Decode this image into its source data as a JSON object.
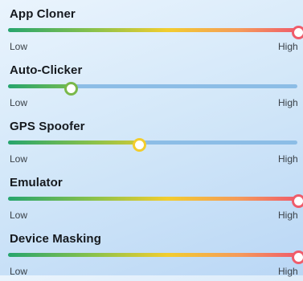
{
  "sliders": [
    {
      "title": "App Cloner",
      "value": 1.0,
      "thumb_color": "#ef5c6b",
      "low": "Low",
      "high": "High"
    },
    {
      "title": "Auto-Clicker",
      "value": 0.215,
      "thumb_color": "#79b84a",
      "low": "Low",
      "high": "High"
    },
    {
      "title": "GPS Spoofer",
      "value": 0.45,
      "thumb_color": "#f2cd2e",
      "low": "Low",
      "high": "High"
    },
    {
      "title": "Emulator",
      "value": 1.0,
      "thumb_color": "#ef5c6b",
      "low": "Low",
      "high": "High"
    },
    {
      "title": "Device Masking",
      "value": 1.0,
      "thumb_color": "#ef5c6b",
      "low": "Low",
      "high": "High"
    }
  ],
  "colors": {
    "track_unfilled": "#8cbde6",
    "gradient_start": "#27a56d",
    "gradient_mid": "#f2cd2e",
    "gradient_end": "#ef5c6b"
  }
}
